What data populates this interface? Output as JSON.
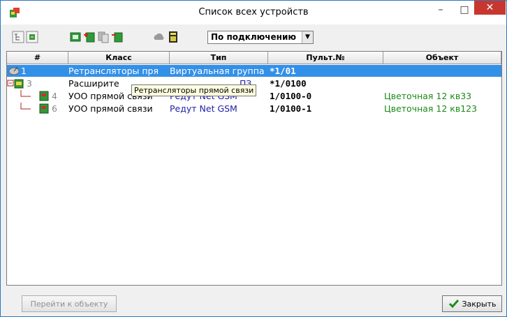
{
  "window": {
    "title": "Список всех устройств",
    "minimize": "–",
    "maximize": "□",
    "close": "✕"
  },
  "toolbar": {
    "combo_value": "По подключению"
  },
  "columns": [
    "#",
    "Класс",
    "Тип",
    "Пульт.№",
    "Объект"
  ],
  "rows": [
    {
      "num": "1",
      "klass": "Ретрансляторы пря",
      "type": "Виртуальная группа",
      "pult": "*1/01",
      "object": "",
      "selected": true
    },
    {
      "num": "3",
      "klass": "Расширите",
      "type": "ПЗ",
      "pult": "*1/0100",
      "object": ""
    },
    {
      "num": "4",
      "klass": "УОО прямой связи",
      "type": "Редут Net GSM",
      "pult": "1/0100-0",
      "object": "Цветочная 12 кв33"
    },
    {
      "num": "6",
      "klass": "УОО прямой связи",
      "type": "Редут Net GSM",
      "pult": "1/0100-1",
      "object": "Цветочная 12 кв123"
    }
  ],
  "tooltip": "Ретрансляторы прямой связи",
  "footer": {
    "goto_label": "Перейти к объекту",
    "close_label": "Закрыть"
  },
  "colors": {
    "selection": "#3390e8",
    "type_text": "#1f1fa8",
    "object_text": "#1a8a1a"
  }
}
